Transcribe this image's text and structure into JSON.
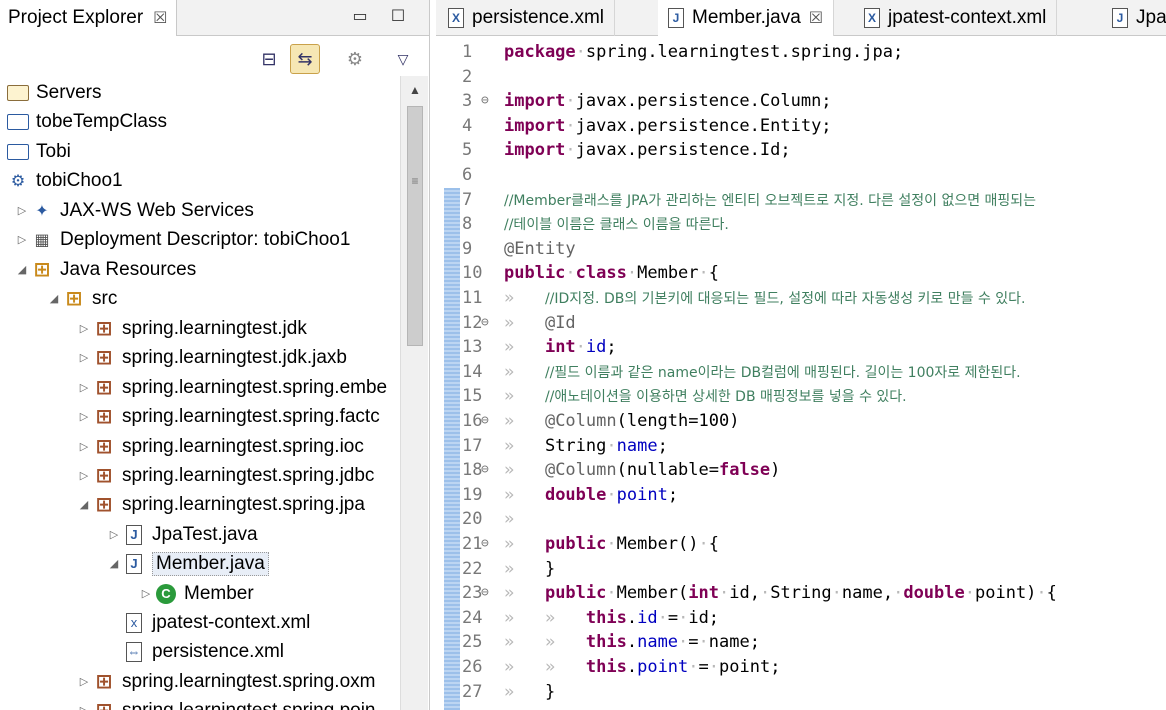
{
  "explorer": {
    "tab_title": "Project Explorer",
    "tab_close": "☒",
    "minimize": "▭",
    "maximize": "☐",
    "toolbar_collapse": "⊟",
    "toolbar_link": "⇆",
    "toolbar_focus": "⚙",
    "toolbar_menu": "▽",
    "scroll_up": "▲",
    "scroll_grip": "≡",
    "tree": [
      {
        "label": "Servers",
        "icon": "folder-open-icon",
        "twisty": ""
      },
      {
        "label": "tobeTempClass",
        "icon": "folder-icon",
        "twisty": ""
      },
      {
        "label": "Tobi",
        "icon": "folder-icon",
        "twisty": ""
      },
      {
        "label": "tobiChoo1",
        "icon": "web-project-icon",
        "twisty": ""
      },
      {
        "label": "JAX-WS Web Services",
        "icon": "webservice-icon",
        "twisty": "▷"
      },
      {
        "label": "Deployment Descriptor: tobiChoo1",
        "icon": "descriptor-icon",
        "twisty": "▷"
      },
      {
        "label": "Java Resources",
        "icon": "java-resources-icon",
        "twisty": "◢"
      },
      {
        "label": "src",
        "icon": "source-folder-icon",
        "twisty": "◢"
      },
      {
        "label": "spring.learningtest.jdk",
        "icon": "package-icon",
        "twisty": "▷"
      },
      {
        "label": "spring.learningtest.jdk.jaxb",
        "icon": "package-icon",
        "twisty": "▷"
      },
      {
        "label": "spring.learningtest.spring.embe",
        "icon": "package-icon",
        "twisty": "▷"
      },
      {
        "label": "spring.learningtest.spring.factc",
        "icon": "package-icon",
        "twisty": "▷"
      },
      {
        "label": "spring.learningtest.spring.ioc",
        "icon": "package-icon",
        "twisty": "▷"
      },
      {
        "label": "spring.learningtest.spring.jdbc",
        "icon": "package-icon",
        "twisty": "▷"
      },
      {
        "label": "spring.learningtest.spring.jpa",
        "icon": "package-icon",
        "twisty": "◢"
      },
      {
        "label": "JpaTest.java",
        "icon": "java-file-icon",
        "twisty": "▷"
      },
      {
        "label": "Member.java",
        "icon": "java-file-icon",
        "twisty": "◢"
      },
      {
        "label": "Member",
        "icon": "class-icon",
        "twisty": "▷"
      },
      {
        "label": "jpatest-context.xml",
        "icon": "xml-file-icon",
        "twisty": ""
      },
      {
        "label": "persistence.xml",
        "icon": "xml-file-icon",
        "twisty": ""
      },
      {
        "label": "spring.learningtest.spring.oxm",
        "icon": "package-icon",
        "twisty": "▷"
      },
      {
        "label": "spring.learningtest.spring.poin",
        "icon": "package-icon",
        "twisty": "▷"
      }
    ]
  },
  "editor": {
    "tabs": [
      {
        "label": "persistence.xml",
        "icon": "X",
        "active": false
      },
      {
        "label": "Member.java",
        "icon": "J",
        "active": true,
        "close": "☒"
      },
      {
        "label": "jpatest-context.xml",
        "icon": "X",
        "active": false
      },
      {
        "label": "JpaT",
        "icon": "J",
        "active": false
      }
    ],
    "lines": [
      {
        "n": "1",
        "fold": "",
        "html": "<span class=\"kw\">package</span><span class=\"ws\">·</span>spring.learningtest.spring.jpa;"
      },
      {
        "n": "2",
        "fold": "",
        "html": ""
      },
      {
        "n": "3",
        "fold": "⊖",
        "html": "<span class=\"kw\">import</span><span class=\"ws\">·</span>javax.persistence.Column;"
      },
      {
        "n": "4",
        "fold": "",
        "html": "<span class=\"kw\">import</span><span class=\"ws\">·</span>javax.persistence.Entity;"
      },
      {
        "n": "5",
        "fold": "",
        "html": "<span class=\"kw\">import</span><span class=\"ws\">·</span>javax.persistence.Id;"
      },
      {
        "n": "6",
        "fold": "",
        "html": ""
      },
      {
        "n": "7",
        "fold": "",
        "html": "<span class=\"cm\">//Member클래스를 JPA가 관리하는 엔티티 오브젝트로 지정. 다른 설정이 없으면 매핑되는</span>"
      },
      {
        "n": "8",
        "fold": "",
        "html": "<span class=\"cm\">//테이블 이름은 클래스 이름을 따른다.</span>"
      },
      {
        "n": "9",
        "fold": "",
        "html": "<span class=\"an\">@Entity</span>"
      },
      {
        "n": "10",
        "fold": "",
        "html": "<span class=\"kw\">public</span><span class=\"ws\">·</span><span class=\"kw\">class</span><span class=\"ws\">·</span>Member<span class=\"ws\">·</span>{"
      },
      {
        "n": "11",
        "fold": "",
        "html": "<span class=\"ws\">»   </span><span class=\"cm\">//ID지정. DB의 기본키에 대응되는 필드, 설정에 따라 자동생성 키로 만들 수 있다.</span>"
      },
      {
        "n": "12",
        "fold": "⊖",
        "html": "<span class=\"ws\">»   </span><span class=\"an\">@Id</span>"
      },
      {
        "n": "13",
        "fold": "",
        "html": "<span class=\"ws\">»   </span><span class=\"kw\">int</span><span class=\"ws\">·</span><span class=\"fd\">id</span>;"
      },
      {
        "n": "14",
        "fold": "",
        "html": "<span class=\"ws\">»   </span><span class=\"cm\">//필드 이름과 같은 name이라는 DB컬럼에 매핑된다. 길이는 100자로 제한된다.</span>"
      },
      {
        "n": "15",
        "fold": "",
        "html": "<span class=\"ws\">»   </span><span class=\"cm\">//애노테이션을 이용하면 상세한 DB 매핑정보를 넣을 수 있다.</span>"
      },
      {
        "n": "16",
        "fold": "⊖",
        "html": "<span class=\"ws\">»   </span><span class=\"an\">@Column</span>(length=100)"
      },
      {
        "n": "17",
        "fold": "",
        "html": "<span class=\"ws\">»   </span>String<span class=\"ws\">·</span><span class=\"fd\">name</span>;"
      },
      {
        "n": "18",
        "fold": "⊖",
        "html": "<span class=\"ws\">»   </span><span class=\"an\">@Column</span>(nullable=<span class=\"kw\">false</span>)"
      },
      {
        "n": "19",
        "fold": "",
        "html": "<span class=\"ws\">»   </span><span class=\"kw\">double</span><span class=\"ws\">·</span><span class=\"fd\">point</span>;"
      },
      {
        "n": "20",
        "fold": "",
        "html": "<span class=\"ws\">»</span>"
      },
      {
        "n": "21",
        "fold": "⊖",
        "html": "<span class=\"ws\">»   </span><span class=\"kw\">public</span><span class=\"ws\">·</span>Member()<span class=\"ws\">·</span>{"
      },
      {
        "n": "22",
        "fold": "",
        "html": "<span class=\"ws\">»   </span>}"
      },
      {
        "n": "23",
        "fold": "⊖",
        "html": "<span class=\"ws\">»   </span><span class=\"kw\">public</span><span class=\"ws\">·</span>Member(<span class=\"kw\">int</span><span class=\"ws\">·</span>id,<span class=\"ws\">·</span>String<span class=\"ws\">·</span>name,<span class=\"ws\">·</span><span class=\"kw\">double</span><span class=\"ws\">·</span>point)<span class=\"ws\">·</span>{"
      },
      {
        "n": "24",
        "fold": "",
        "html": "<span class=\"ws\">»   »   </span><span class=\"kw\">this</span>.<span class=\"fd\">id</span><span class=\"ws\">·</span>=<span class=\"ws\">·</span>id;"
      },
      {
        "n": "25",
        "fold": "",
        "html": "<span class=\"ws\">»   »   </span><span class=\"kw\">this</span>.<span class=\"fd\">name</span><span class=\"ws\">·</span>=<span class=\"ws\">·</span>name;"
      },
      {
        "n": "26",
        "fold": "",
        "html": "<span class=\"ws\">»   »   </span><span class=\"kw\">this</span>.<span class=\"fd\">point</span><span class=\"ws\">·</span>=<span class=\"ws\">·</span>point;"
      },
      {
        "n": "27",
        "fold": "",
        "html": "<span class=\"ws\">»   </span>}"
      }
    ]
  }
}
